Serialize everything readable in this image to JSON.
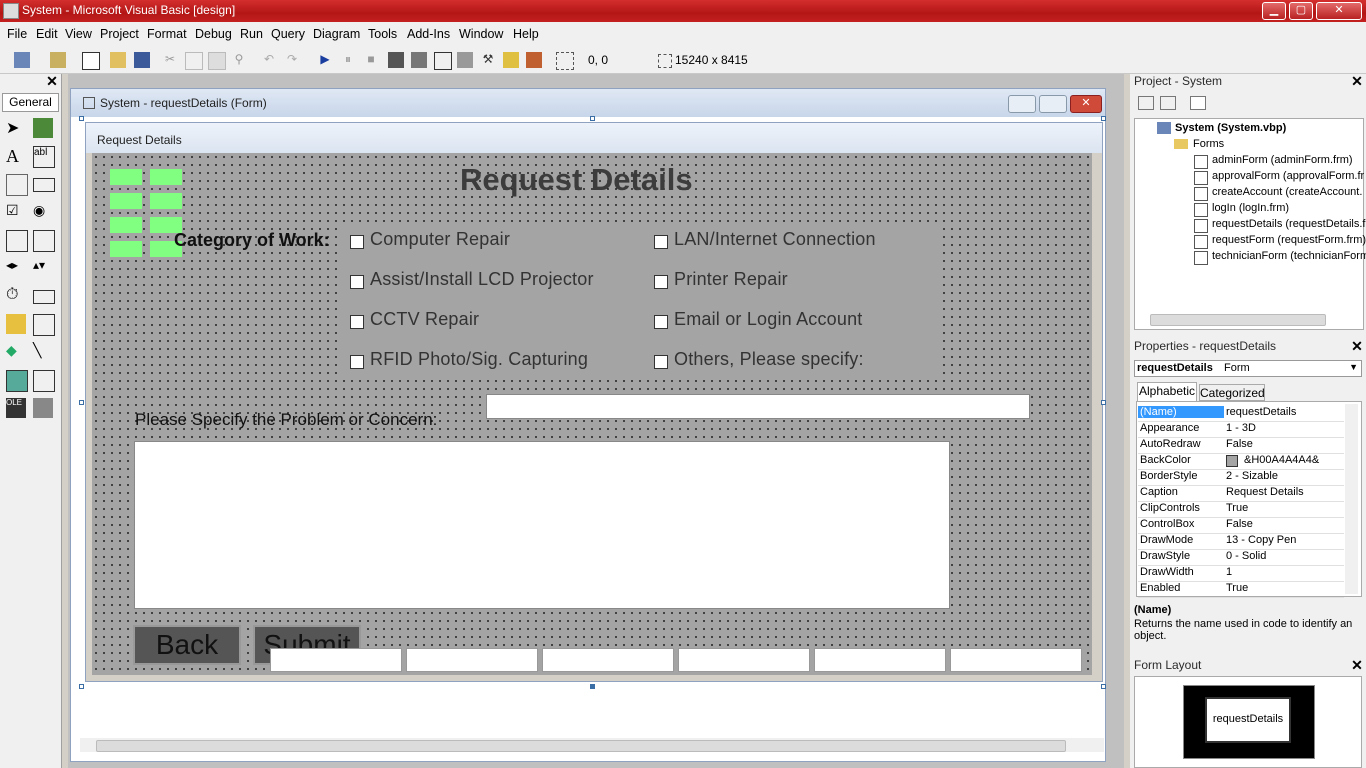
{
  "window": {
    "title": "System - Microsoft Visual Basic [design]",
    "minimize": "▁",
    "maximize": "▢",
    "close": "✕"
  },
  "menu": [
    "File",
    "Edit",
    "View",
    "Project",
    "Format",
    "Debug",
    "Run",
    "Query",
    "Diagram",
    "Tools",
    "Add-Ins",
    "Window",
    "Help"
  ],
  "toolbar": {
    "coords": "0, 0",
    "size": "15240 x 8415"
  },
  "toolbox": {
    "tab_label": "General",
    "close": "✕"
  },
  "form_window": {
    "title": "System - requestDetails (Form)"
  },
  "form": {
    "caption": "Request Details",
    "heading": "Request Details",
    "category_label": "Category of Work:",
    "checkboxes_left": [
      "Computer Repair",
      "Assist/Install LCD Projector",
      "CCTV Repair",
      "RFID Photo/Sig. Capturing"
    ],
    "checkboxes_right": [
      "LAN/Internet Connection",
      "Printer Repair",
      "Email or Login Account",
      "Others, Please specify:"
    ],
    "others_input_value": "",
    "problem_label": "Please Specify the Problem or Concern:",
    "problem_text": "",
    "back_button": "Back",
    "submit_button": "Submit"
  },
  "project_panel": {
    "title": "Project - System",
    "root": "System (System.vbp)",
    "folder": "Forms",
    "forms": [
      "adminForm (adminForm.frm)",
      "approvalForm (approvalForm.fr",
      "createAccount (createAccount.",
      "logIn (logIn.frm)",
      "requestDetails (requestDetails.f",
      "requestForm (requestForm.frm)",
      "technicianForm (technicianForm"
    ]
  },
  "properties_panel": {
    "title": "Properties - requestDetails",
    "object_name": "requestDetails",
    "object_type": "Form",
    "tabs": [
      "Alphabetic",
      "Categorized"
    ],
    "rows": [
      {
        "name": "(Name)",
        "value": "requestDetails"
      },
      {
        "name": "Appearance",
        "value": "1 - 3D"
      },
      {
        "name": "AutoRedraw",
        "value": "False"
      },
      {
        "name": "BackColor",
        "value": "&H00A4A4A4&"
      },
      {
        "name": "BorderStyle",
        "value": "2 - Sizable"
      },
      {
        "name": "Caption",
        "value": "Request Details"
      },
      {
        "name": "ClipControls",
        "value": "True"
      },
      {
        "name": "ControlBox",
        "value": "False"
      },
      {
        "name": "DrawMode",
        "value": "13 - Copy Pen"
      },
      {
        "name": "DrawStyle",
        "value": "0 - Solid"
      },
      {
        "name": "DrawWidth",
        "value": "1"
      },
      {
        "name": "Enabled",
        "value": "True"
      }
    ],
    "desc_title": "(Name)",
    "desc_text": "Returns the name used in code to identify an object."
  },
  "layout_panel": {
    "title": "Form Layout",
    "form_label": "requestDetails"
  },
  "colors": {
    "titlebar": "#c42020",
    "form_back": "#a4a4a4",
    "selected_row": "#3399ff",
    "logo_green": "#80ff80"
  }
}
